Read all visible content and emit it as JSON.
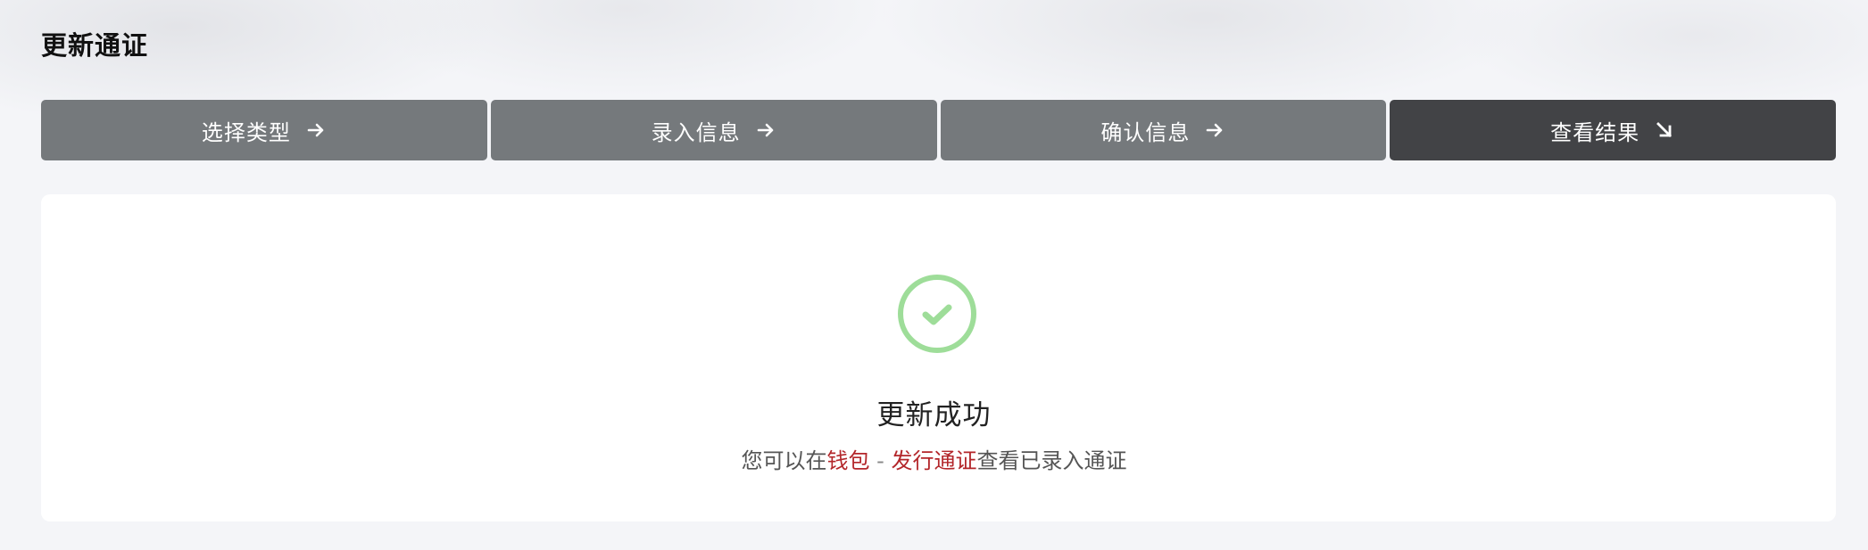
{
  "page": {
    "title": "更新通证"
  },
  "steps": [
    {
      "label": "选择类型",
      "icon": "arrow-right-icon",
      "active": false
    },
    {
      "label": "录入信息",
      "icon": "arrow-right-icon",
      "active": false
    },
    {
      "label": "确认信息",
      "icon": "arrow-right-icon",
      "active": false
    },
    {
      "label": "查看结果",
      "icon": "arrow-down-right-icon",
      "active": true
    }
  ],
  "result": {
    "icon": "check-circle-icon",
    "title": "更新成功",
    "desc_prefix": "您可以在",
    "link_wallet": "钱包",
    "separator": " - ",
    "link_issue": "发行通证",
    "desc_suffix": "查看已录入通证"
  },
  "colors": {
    "step_inactive": "#75797c",
    "step_active": "#424346",
    "success_green": "#9edd99",
    "link_red": "#b3262a"
  }
}
